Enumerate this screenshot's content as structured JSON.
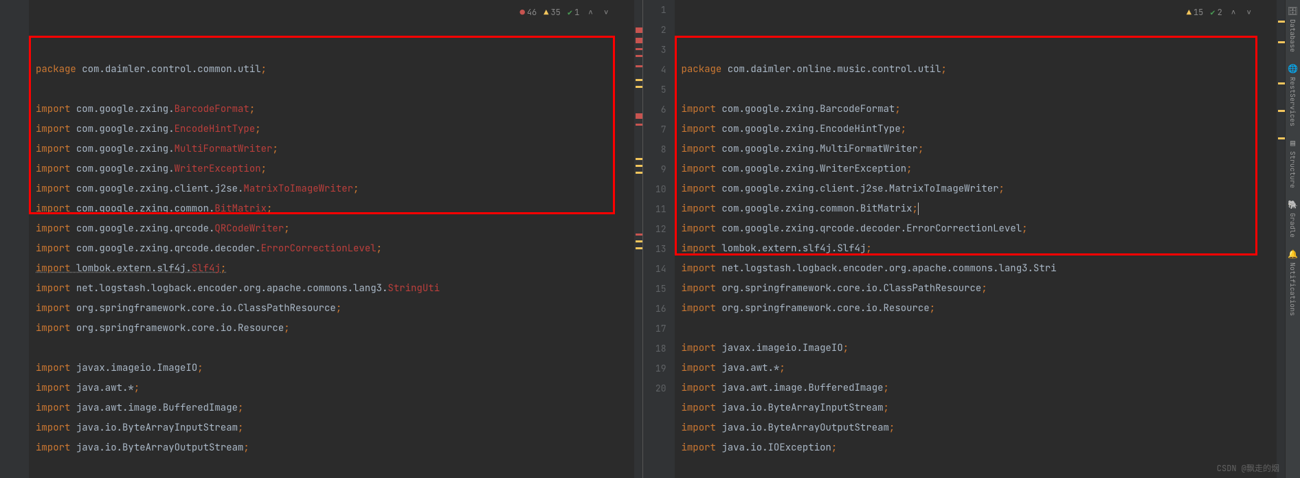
{
  "left": {
    "package_kw": "package",
    "package_path": "com.daimler.control.common.util",
    "inspections": {
      "errors": "46",
      "warnings": "35",
      "checks": "1"
    },
    "lines": [
      {
        "t": "pkg",
        "kw": "package",
        "path": "com.daimler.control.common.util",
        "tail": ";"
      },
      {
        "t": "blank"
      },
      {
        "t": "imp_err",
        "kw": "import",
        "path": "com.google.zxing.",
        "cls": "BarcodeFormat",
        "tail": ";"
      },
      {
        "t": "imp_err",
        "kw": "import",
        "path": "com.google.zxing.",
        "cls": "EncodeHintType",
        "tail": ";"
      },
      {
        "t": "imp_err",
        "kw": "import",
        "path": "com.google.zxing.",
        "cls": "MultiFormatWriter",
        "tail": ";"
      },
      {
        "t": "imp_err",
        "kw": "import",
        "path": "com.google.zxing.",
        "cls": "WriterException",
        "tail": ";"
      },
      {
        "t": "imp_err",
        "kw": "import",
        "path": "com.google.zxing.client.j2se.",
        "cls": "MatrixToImageWriter",
        "tail": ";"
      },
      {
        "t": "imp_err",
        "kw": "import",
        "path": "com.google.zxing.common.",
        "cls": "BitMatrix",
        "tail": ";"
      },
      {
        "t": "imp_err",
        "kw": "import",
        "path": "com.google.zxing.qrcode.",
        "cls": "QRCodeWriter",
        "tail": ";"
      },
      {
        "t": "imp_err",
        "kw": "import",
        "path": "com.google.zxing.qrcode.decoder.",
        "cls": "ErrorCorrectionLevel",
        "tail": ";"
      },
      {
        "t": "imp_err_u",
        "kw": "import",
        "path": "lombok.extern.slf4j.",
        "cls": "Slf4j",
        "tail": ";"
      },
      {
        "t": "imp_warn",
        "kw": "import",
        "path": "net.logstash.logback.encoder.org.apache.commons.lang3.",
        "cls": "StringUti",
        "tail": ""
      },
      {
        "t": "imp",
        "kw": "import",
        "path": "org.springframework.core.io.",
        "cls": "ClassPathResource",
        "tail": ";"
      },
      {
        "t": "imp",
        "kw": "import",
        "path": "org.springframework.core.io.",
        "cls": "Resource",
        "tail": ";"
      },
      {
        "t": "blank"
      },
      {
        "t": "imp",
        "kw": "import",
        "path": "javax.imageio.",
        "cls": "ImageIO",
        "tail": ";"
      },
      {
        "t": "imp",
        "kw": "import",
        "path": "java.awt.",
        "cls": "*",
        "tail": ";"
      },
      {
        "t": "imp",
        "kw": "import",
        "path": "java.awt.image.",
        "cls": "BufferedImage",
        "tail": ";"
      },
      {
        "t": "imp",
        "kw": "import",
        "path": "java.io.",
        "cls": "ByteArrayInputStream",
        "tail": ";"
      },
      {
        "t": "imp",
        "kw": "import",
        "path": "java.io.",
        "cls": "ByteArrayOutputStream",
        "tail": ";"
      }
    ]
  },
  "right": {
    "inspections": {
      "warnings": "15",
      "checks": "2"
    },
    "line_numbers": [
      "1",
      "2",
      "3",
      "4",
      "5",
      "6",
      "7",
      "8",
      "9",
      "10",
      "11",
      "12",
      "13",
      "14",
      "15",
      "16",
      "17",
      "18",
      "19",
      "20"
    ],
    "lines": [
      {
        "t": "pkg",
        "kw": "package",
        "path": "com.daimler.online.music.control.util",
        "tail": ";"
      },
      {
        "t": "blank"
      },
      {
        "t": "imp",
        "kw": "import",
        "path": "com.google.zxing.",
        "cls": "BarcodeFormat",
        "tail": ";"
      },
      {
        "t": "imp",
        "kw": "import",
        "path": "com.google.zxing.",
        "cls": "EncodeHintType",
        "tail": ";"
      },
      {
        "t": "imp",
        "kw": "import",
        "path": "com.google.zxing.",
        "cls": "MultiFormatWriter",
        "tail": ";"
      },
      {
        "t": "imp",
        "kw": "import",
        "path": "com.google.zxing.",
        "cls": "WriterException",
        "tail": ";"
      },
      {
        "t": "imp",
        "kw": "import",
        "path": "com.google.zxing.client.j2se.",
        "cls": "MatrixToImageWriter",
        "tail": ";"
      },
      {
        "t": "imp_cursor",
        "kw": "import",
        "path": "com.google.zxing.common.",
        "cls": "BitMatrix",
        "tail": ";"
      },
      {
        "t": "imp",
        "kw": "import",
        "path": "com.google.zxing.qrcode.decoder.",
        "cls": "ErrorCorrectionLevel",
        "tail": ";"
      },
      {
        "t": "imp",
        "kw": "import",
        "path": "lombok.extern.slf4j.",
        "cls": "Slf4j",
        "tail": ";"
      },
      {
        "t": "imp_trunc",
        "kw": "import",
        "path": "net.logstash.logback.encoder.org.apache.commons.lang3.",
        "cls": "Stri",
        "tail": ""
      },
      {
        "t": "imp",
        "kw": "import",
        "path": "org.springframework.core.io.",
        "cls": "ClassPathResource",
        "tail": ";"
      },
      {
        "t": "imp",
        "kw": "import",
        "path": "org.springframework.core.io.",
        "cls": "Resource",
        "tail": ";"
      },
      {
        "t": "blank"
      },
      {
        "t": "imp",
        "kw": "import",
        "path": "javax.imageio.",
        "cls": "ImageIO",
        "tail": ";"
      },
      {
        "t": "imp",
        "kw": "import",
        "path": "java.awt.",
        "cls": "*",
        "tail": ";"
      },
      {
        "t": "imp",
        "kw": "import",
        "path": "java.awt.image.",
        "cls": "BufferedImage",
        "tail": ";"
      },
      {
        "t": "imp",
        "kw": "import",
        "path": "java.io.",
        "cls": "ByteArrayInputStream",
        "tail": ";"
      },
      {
        "t": "imp",
        "kw": "import",
        "path": "java.io.",
        "cls": "ByteArrayOutputStream",
        "tail": ";"
      },
      {
        "t": "imp",
        "kw": "import",
        "path": "java.io.",
        "cls": "IOException",
        "tail": ";"
      }
    ]
  },
  "tools": {
    "database": "Database",
    "rest": "RestServices",
    "structure": "Structure",
    "gradle": "Gradle",
    "notifications": "Notifications"
  },
  "watermark": "CSDN @飘走的烟"
}
